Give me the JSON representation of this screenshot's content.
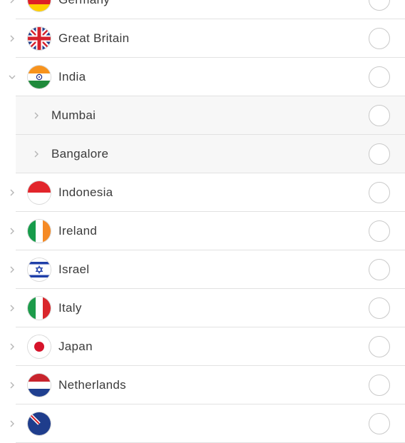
{
  "countries": [
    {
      "label": "Germany",
      "icon": "germany-flag-icon",
      "expanded": false
    },
    {
      "label": "Great Britain",
      "icon": "great-britain-flag-icon",
      "expanded": false
    },
    {
      "label": "India",
      "icon": "india-flag-icon",
      "expanded": true,
      "cities": [
        {
          "label": "Mumbai"
        },
        {
          "label": "Bangalore"
        }
      ]
    },
    {
      "label": "Indonesia",
      "icon": "indonesia-flag-icon",
      "expanded": false
    },
    {
      "label": "Ireland",
      "icon": "ireland-flag-icon",
      "expanded": false
    },
    {
      "label": "Israel",
      "icon": "israel-flag-icon",
      "expanded": false
    },
    {
      "label": "Italy",
      "icon": "italy-flag-icon",
      "expanded": false
    },
    {
      "label": "Japan",
      "icon": "japan-flag-icon",
      "expanded": false
    },
    {
      "label": "Netherlands",
      "icon": "netherlands-flag-icon",
      "expanded": false
    },
    {
      "label": "",
      "icon": "partial-flag-icon",
      "expanded": false
    }
  ],
  "colors": {
    "divider": "#e2e2e2",
    "radio_border": "#c9c9c9",
    "text": "#3b3b3b",
    "chevron": "#b5b5b5"
  }
}
